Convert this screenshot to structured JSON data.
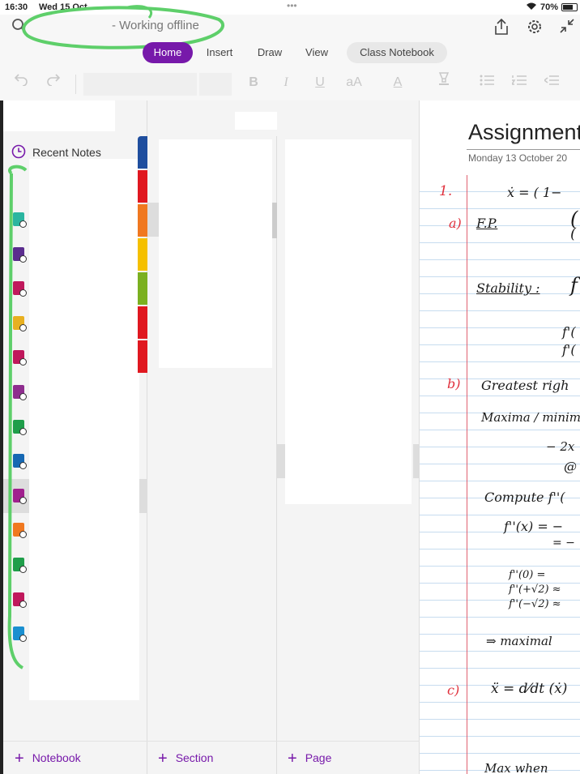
{
  "status": {
    "time": "16:30",
    "date": "Wed 15 Oct",
    "battery": "70%",
    "colors": {
      "battery": "#222222"
    }
  },
  "header": {
    "title": "- Working offline",
    "dots": "•••"
  },
  "tabs": [
    {
      "label": "Home",
      "active": true
    },
    {
      "label": "Insert",
      "active": false
    },
    {
      "label": "Draw",
      "active": false
    },
    {
      "label": "View",
      "active": false
    },
    {
      "label": "Class Notebook",
      "active": false
    }
  ],
  "toolbar": {
    "font_size_icon": "aA",
    "font_color_icon": "A",
    "bold": "B",
    "italic": "I",
    "underline": "U"
  },
  "sidebar": {
    "recent_notes": "Recent Notes",
    "notebook_colors": [
      "#2ab5a0",
      "#5b2d8e",
      "#c0185c",
      "#e8b020",
      "#c0185c",
      "#8e2d8e",
      "#1f9e4a",
      "#1668b3",
      "#a0208e",
      "#f07820",
      "#1f9e4a",
      "#c0185c",
      "#1a8fd0"
    ],
    "add_notebook": "Notebook"
  },
  "sections": {
    "more": "•••",
    "tab_colors": [
      "#1f4e9e",
      "#e01820",
      "#f07820",
      "#f5c000",
      "#7bb020",
      "#e01820",
      "#e01820"
    ],
    "add_section": "Section"
  },
  "pages": {
    "add_page": "Page"
  },
  "note": {
    "title": "Assignment",
    "date": "Monday 13 October 20",
    "lines": {
      "q1_number": "1.",
      "q1_eq": "ẋ  =   ( 1−",
      "a_label": "a)",
      "a_text": "F.P.",
      "stability": "Stability :",
      "f_prime_1": "f'(",
      "f_prime_2": "f'(",
      "b_label": "b)",
      "b_text": "Greatest  righ",
      "b_text2": "Maxima / minim",
      "b_eq1": "− 2x",
      "b_eq2": "@",
      "compute": "Compute   f''(",
      "f2x": "f''(x) =  −",
      "f2x_b": "=  −",
      "f2_0": "f''(0)  =",
      "f2_p": "f''(+√2) ≈",
      "f2_m": "f''(−√2) ≈",
      "maximal": "⇒  maximal",
      "c_label": "c)",
      "c_eq": "ẍ  =   d⁄dt (ẋ)",
      "max_when": "Max  when"
    }
  }
}
